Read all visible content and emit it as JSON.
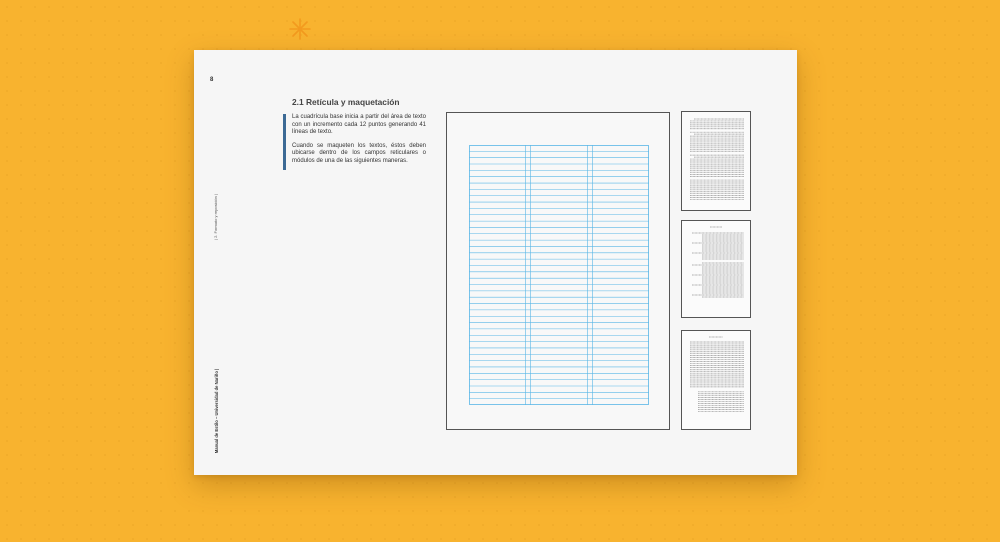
{
  "page": {
    "number": "8",
    "chapter_label": "| 2. Formato y reposición |",
    "publication_label": "Manual de Estilo – Universidad de Nariño |",
    "section_title": "2.1 Retícula y maquetación",
    "paragraphs": [
      "La cuadrícula base inicia a partir del área de texto con un incremento cada 12 puntos generando 41 líneas de texto.",
      "Cuando se maqueten los textos, éstos deben ubicarse dentro de los campos reticulares o módulos de una de las siguientes maneras."
    ]
  },
  "grid": {
    "baseline_lines": 41,
    "columns": 3
  },
  "colors": {
    "background": "#f8b32f",
    "grid_lines": "#59b6e6",
    "accent": "#3c6a95"
  },
  "icons": {
    "decoration": "sparkle-icon"
  }
}
